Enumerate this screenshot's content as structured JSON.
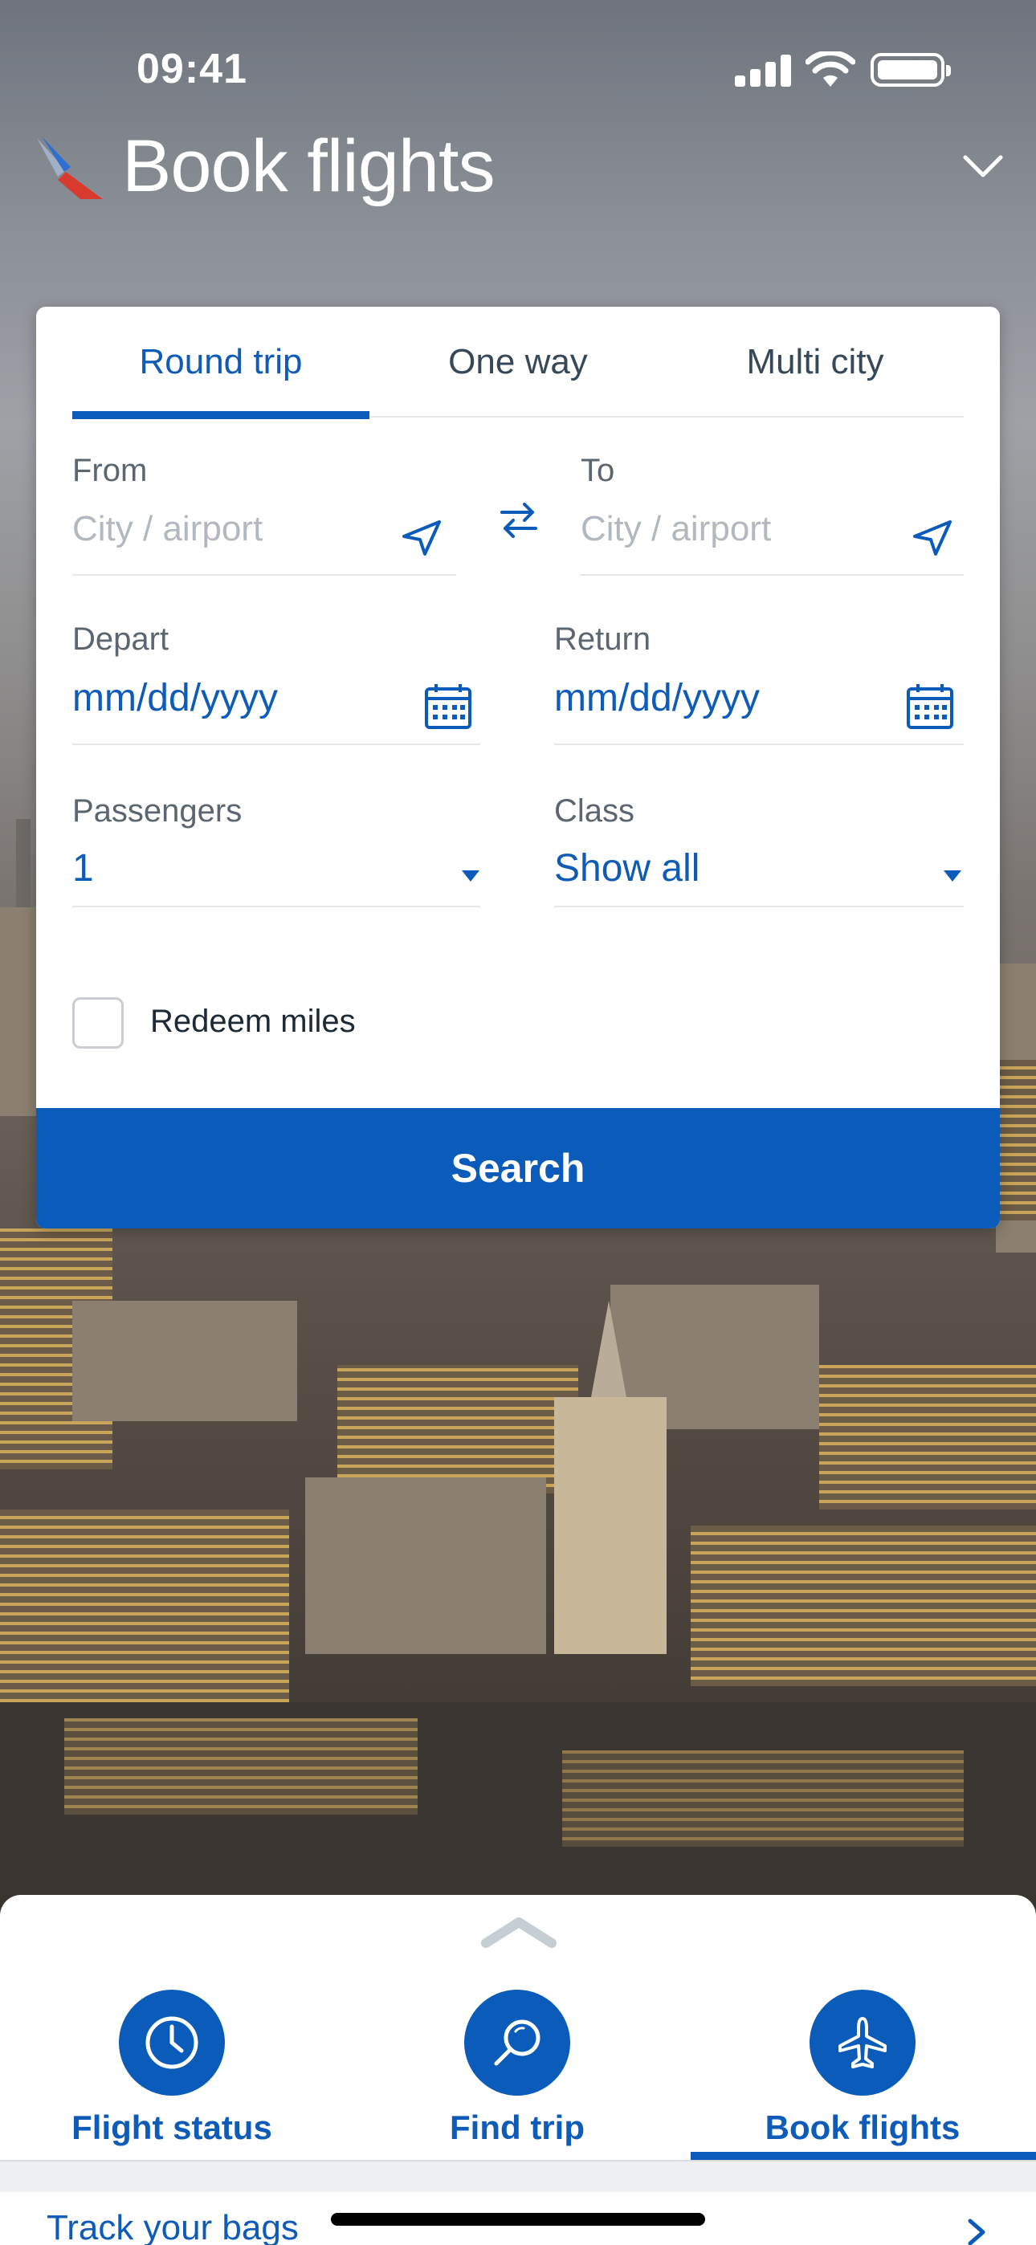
{
  "status_bar": {
    "time": "09:41"
  },
  "header": {
    "title": "Book flights"
  },
  "trip_tabs": [
    {
      "label": "Round trip",
      "active": true
    },
    {
      "label": "One way",
      "active": false
    },
    {
      "label": "Multi city",
      "active": false
    }
  ],
  "form": {
    "from": {
      "label": "From",
      "placeholder": "City / airport"
    },
    "to": {
      "label": "To",
      "placeholder": "City / airport"
    },
    "depart": {
      "label": "Depart",
      "value": "mm/dd/yyyy"
    },
    "return": {
      "label": "Return",
      "value": "mm/dd/yyyy"
    },
    "passengers": {
      "label": "Passengers",
      "value": "1"
    },
    "class": {
      "label": "Class",
      "value": "Show all"
    },
    "redeem_miles": {
      "label": "Redeem miles",
      "checked": false
    },
    "search_label": "Search"
  },
  "bottom_sheet": {
    "actions": [
      {
        "label": "Flight status",
        "icon": "clock-icon",
        "active": false
      },
      {
        "label": "Find trip",
        "icon": "magnifier-icon",
        "active": false
      },
      {
        "label": "Book flights",
        "icon": "airplane-icon",
        "active": true
      }
    ],
    "track_bags_label": "Track your bags"
  },
  "colors": {
    "brand_blue": "#0B5BBB",
    "text_blue": "#0F5BB8",
    "label_gray": "#5B6670",
    "placeholder_gray": "#B2B8BF"
  }
}
